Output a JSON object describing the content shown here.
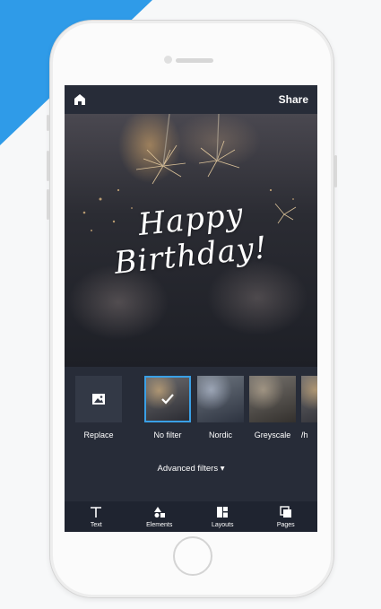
{
  "background": {
    "accent_color": "#2f9be8"
  },
  "app": {
    "topbar": {
      "home_icon": "home-icon",
      "share_label": "Share"
    },
    "photo": {
      "greeting_line1": "Happy",
      "greeting_line2": "Birthday!"
    },
    "filters": {
      "replace": {
        "label": "Replace",
        "icon": "image-icon"
      },
      "items": [
        {
          "label": "No filter",
          "selected": true
        },
        {
          "label": "Nordic",
          "selected": false
        },
        {
          "label": "Greyscale",
          "selected": false
        },
        {
          "label": "Wh",
          "selected": false
        }
      ]
    },
    "advanced_filters": "Advanced filters ▾",
    "tabs": [
      {
        "label": "Text",
        "icon": "text-icon"
      },
      {
        "label": "Elements",
        "icon": "elements-icon"
      },
      {
        "label": "Layouts",
        "icon": "layouts-icon"
      },
      {
        "label": "Pages",
        "icon": "pages-icon"
      }
    ],
    "accent_color": "#3aa0e6"
  }
}
